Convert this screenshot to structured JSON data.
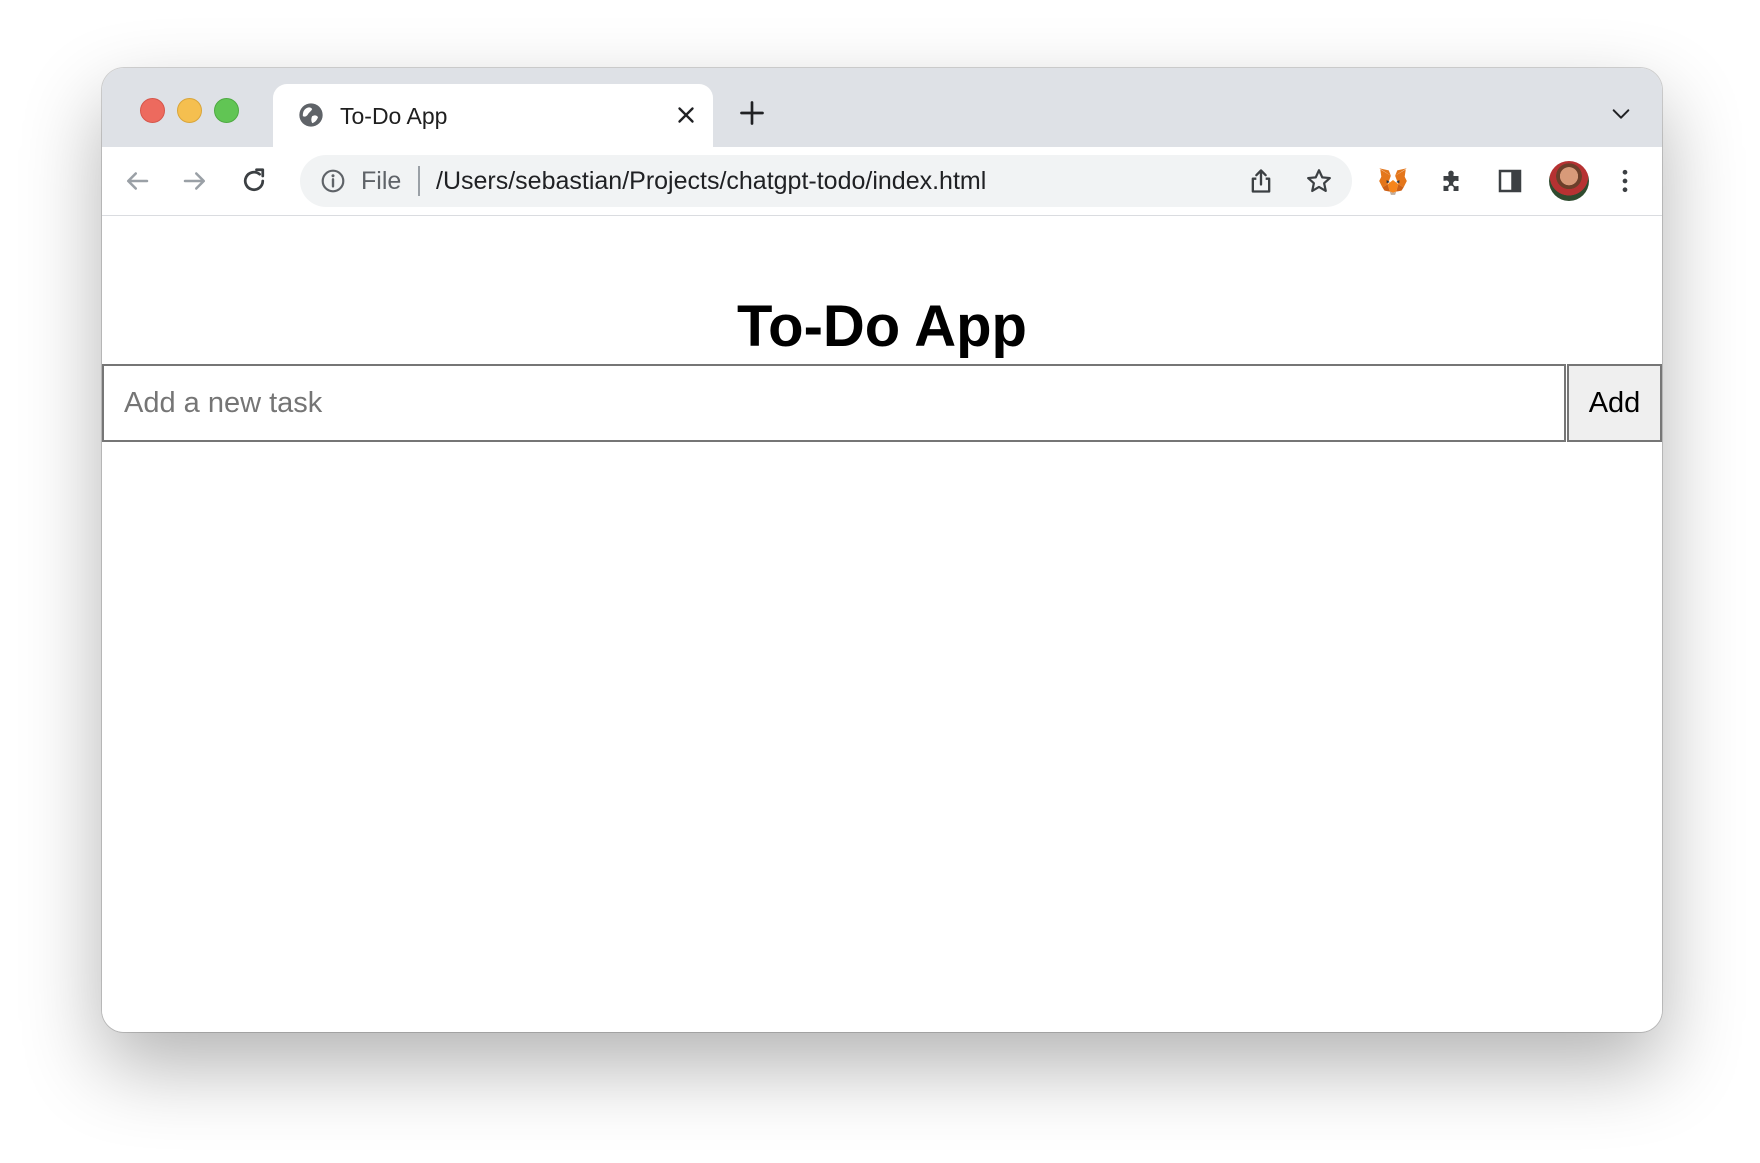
{
  "window": {
    "controls": [
      "close",
      "minimize",
      "maximize"
    ]
  },
  "tabbar": {
    "tabs": [
      {
        "title": "To-Do App",
        "favicon": "globe-icon",
        "active": true
      }
    ],
    "new_tab_icon": "plus-icon",
    "tab_list_icon": "chevron-down-icon"
  },
  "toolbar": {
    "back_icon": "arrow-left-icon",
    "forward_icon": "arrow-right-icon",
    "reload_icon": "reload-icon",
    "omnibox": {
      "security_icon": "info-icon",
      "scheme_label": "File",
      "url": "/Users/sebastian/Projects/chatgpt-todo/index.html",
      "share_icon": "share-icon",
      "bookmark_icon": "star-icon"
    },
    "extensions": [
      "metamask-fox-icon",
      "puzzle-icon",
      "side-panel-icon"
    ],
    "avatar_icon": "profile-avatar",
    "menu_icon": "more-vertical-icon"
  },
  "page": {
    "title": "To-Do App",
    "input": {
      "value": "",
      "placeholder": "Add a new task"
    },
    "add_button_label": "Add"
  },
  "colors": {
    "tab_strip": "#dee1e6",
    "omnibox": "#f1f3f4",
    "traffic_close": "#ed6a5e",
    "traffic_minimize": "#f5bf4f",
    "traffic_maximize": "#61c554"
  }
}
